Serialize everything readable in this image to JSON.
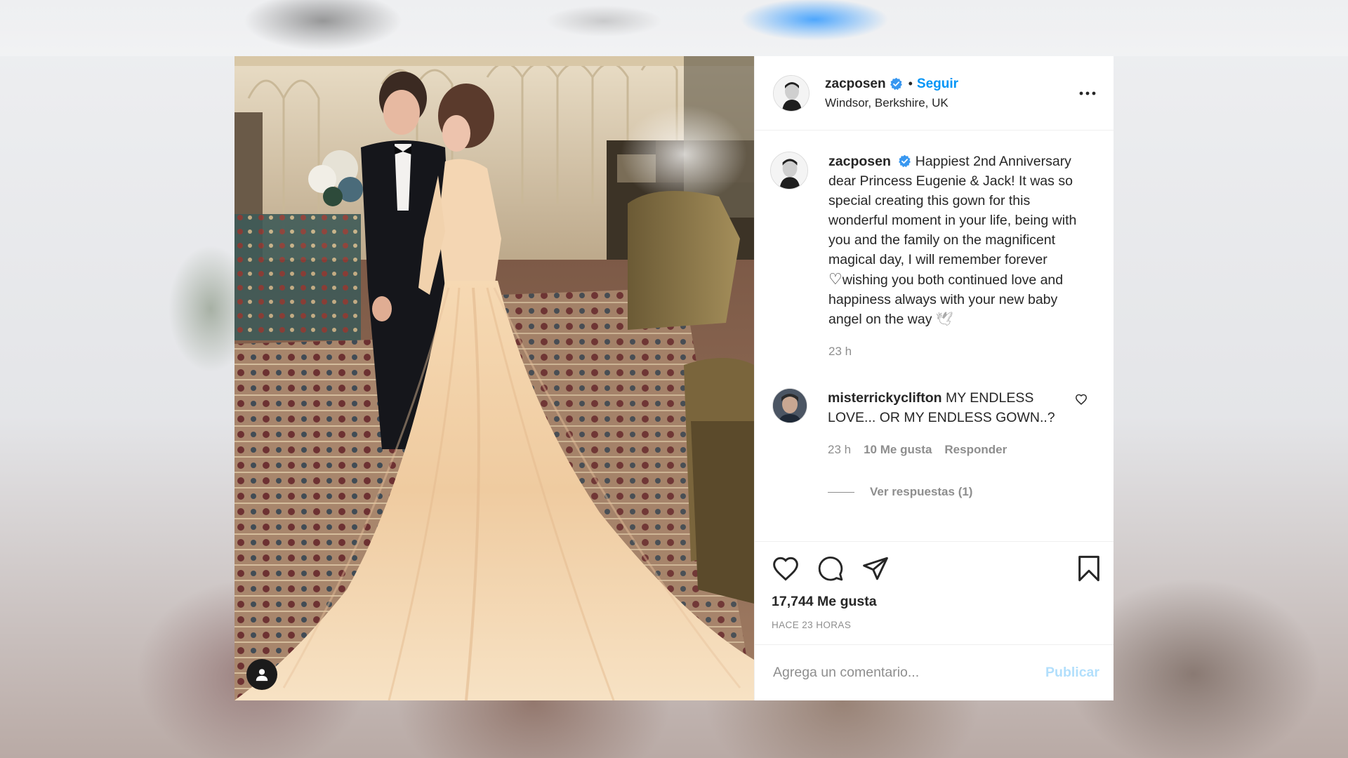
{
  "post": {
    "author": {
      "username": "zacposen",
      "verified": true,
      "location": "Windsor, Berkshire, UK"
    },
    "follow_separator": "•",
    "follow_label": "Seguir",
    "more_icon": "more-horizontal-icon",
    "photo": {
      "description": "A bride in a long pale peach gown with a flowing train and a groom in a black tuxedo standing in an ornate room with patterned carpets",
      "tag_icon": "user-tag-icon"
    },
    "caption": {
      "text_part1": "Happiest 2nd Anniversary dear Princess Eugenie & Jack! It was so special creating this gown for this wonderful moment in your life, being with you and the family on the magnificent magical day, I will remember forever ",
      "heart_glyph": "♡",
      "text_part2": "wishing you both continued love and happiness always with your new baby angel on the way ",
      "dove_glyph": "🕊",
      "time": "23 h"
    },
    "comments": [
      {
        "username": "misterrickyclifton",
        "text": "MY ENDLESS LOVE... OR MY ENDLESS GOWN..?",
        "time": "23 h",
        "likes": "10 Me gusta",
        "reply_label": "Responder",
        "view_replies": "Ver respuestas (1)"
      }
    ],
    "actions": {
      "like_icon": "heart-icon",
      "comment_icon": "comment-icon",
      "share_icon": "share-icon",
      "save_icon": "bookmark-icon"
    },
    "likes": "17,744 Me gusta",
    "posted_ago": "HACE 23 HORAS",
    "add_comment": {
      "placeholder": "Agrega un comentario...",
      "publish_label": "Publicar"
    }
  },
  "colors": {
    "accent": "#0095f6",
    "publish_disabled": "#b2dffc",
    "text": "#262626",
    "muted": "#8e8e8e"
  }
}
